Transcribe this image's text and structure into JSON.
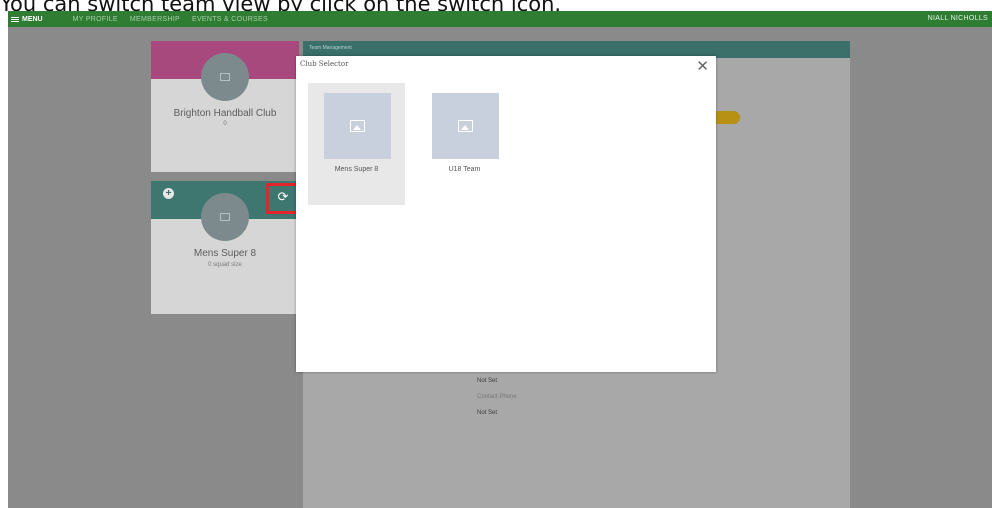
{
  "caption": "You can switch team view by click on the switch icon.",
  "topbar": {
    "menu_label": "MENU",
    "nav": [
      "MY PROFILE",
      "MEMBERSHIP",
      "EVENTS & COURSES"
    ],
    "user": "NIALL NICHOLLS"
  },
  "club_card": {
    "name": "Brighton Handball Club",
    "sub": "0",
    "color": "#a8497d"
  },
  "team_card": {
    "name": "Mens Super 8",
    "sub": "0 squad size",
    "color": "#3e7670"
  },
  "team_management": {
    "header": "Team Management",
    "values": [
      "Not Set",
      "Contact Phone",
      "Not Set"
    ]
  },
  "modal": {
    "title": "Club Selector",
    "close_label": "✕",
    "teams": [
      {
        "label": "Mens Super 8",
        "selected": true
      },
      {
        "label": "U18 Team",
        "selected": false
      }
    ]
  },
  "accent_colors": {
    "topbar": "#2e7d32",
    "highlight": "#e3242b",
    "badge": "#b69114"
  }
}
